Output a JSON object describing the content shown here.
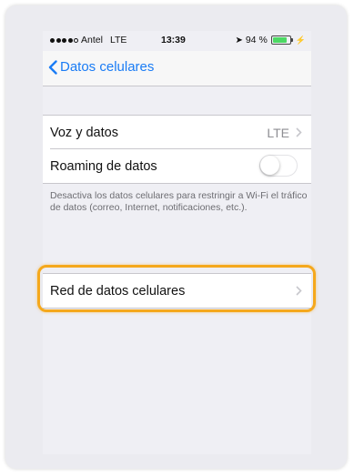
{
  "status_bar": {
    "carrier": "Antel",
    "network": "LTE",
    "time": "13:39",
    "battery_percent": "94 %",
    "battery_level": 0.94,
    "icons": [
      "signal-dots-icon",
      "location-arrow-icon",
      "battery-icon",
      "charging-bolt-icon"
    ]
  },
  "navbar": {
    "back_label": "Datos celulares",
    "back_icon": "chevron-left-icon",
    "accent_color": "#1a7cf5"
  },
  "section1": {
    "voz": {
      "label": "Voz y datos",
      "value": "LTE"
    },
    "roaming": {
      "label": "Roaming de datos",
      "enabled": false
    }
  },
  "footnote": "Desactiva los datos celulares para restringir a Wi-Fi el tráfico de datos (correo, Internet, notificaciones, etc.).",
  "section2": {
    "red": {
      "label": "Red de datos celulares"
    }
  },
  "highlight_color": "#f5a81c"
}
